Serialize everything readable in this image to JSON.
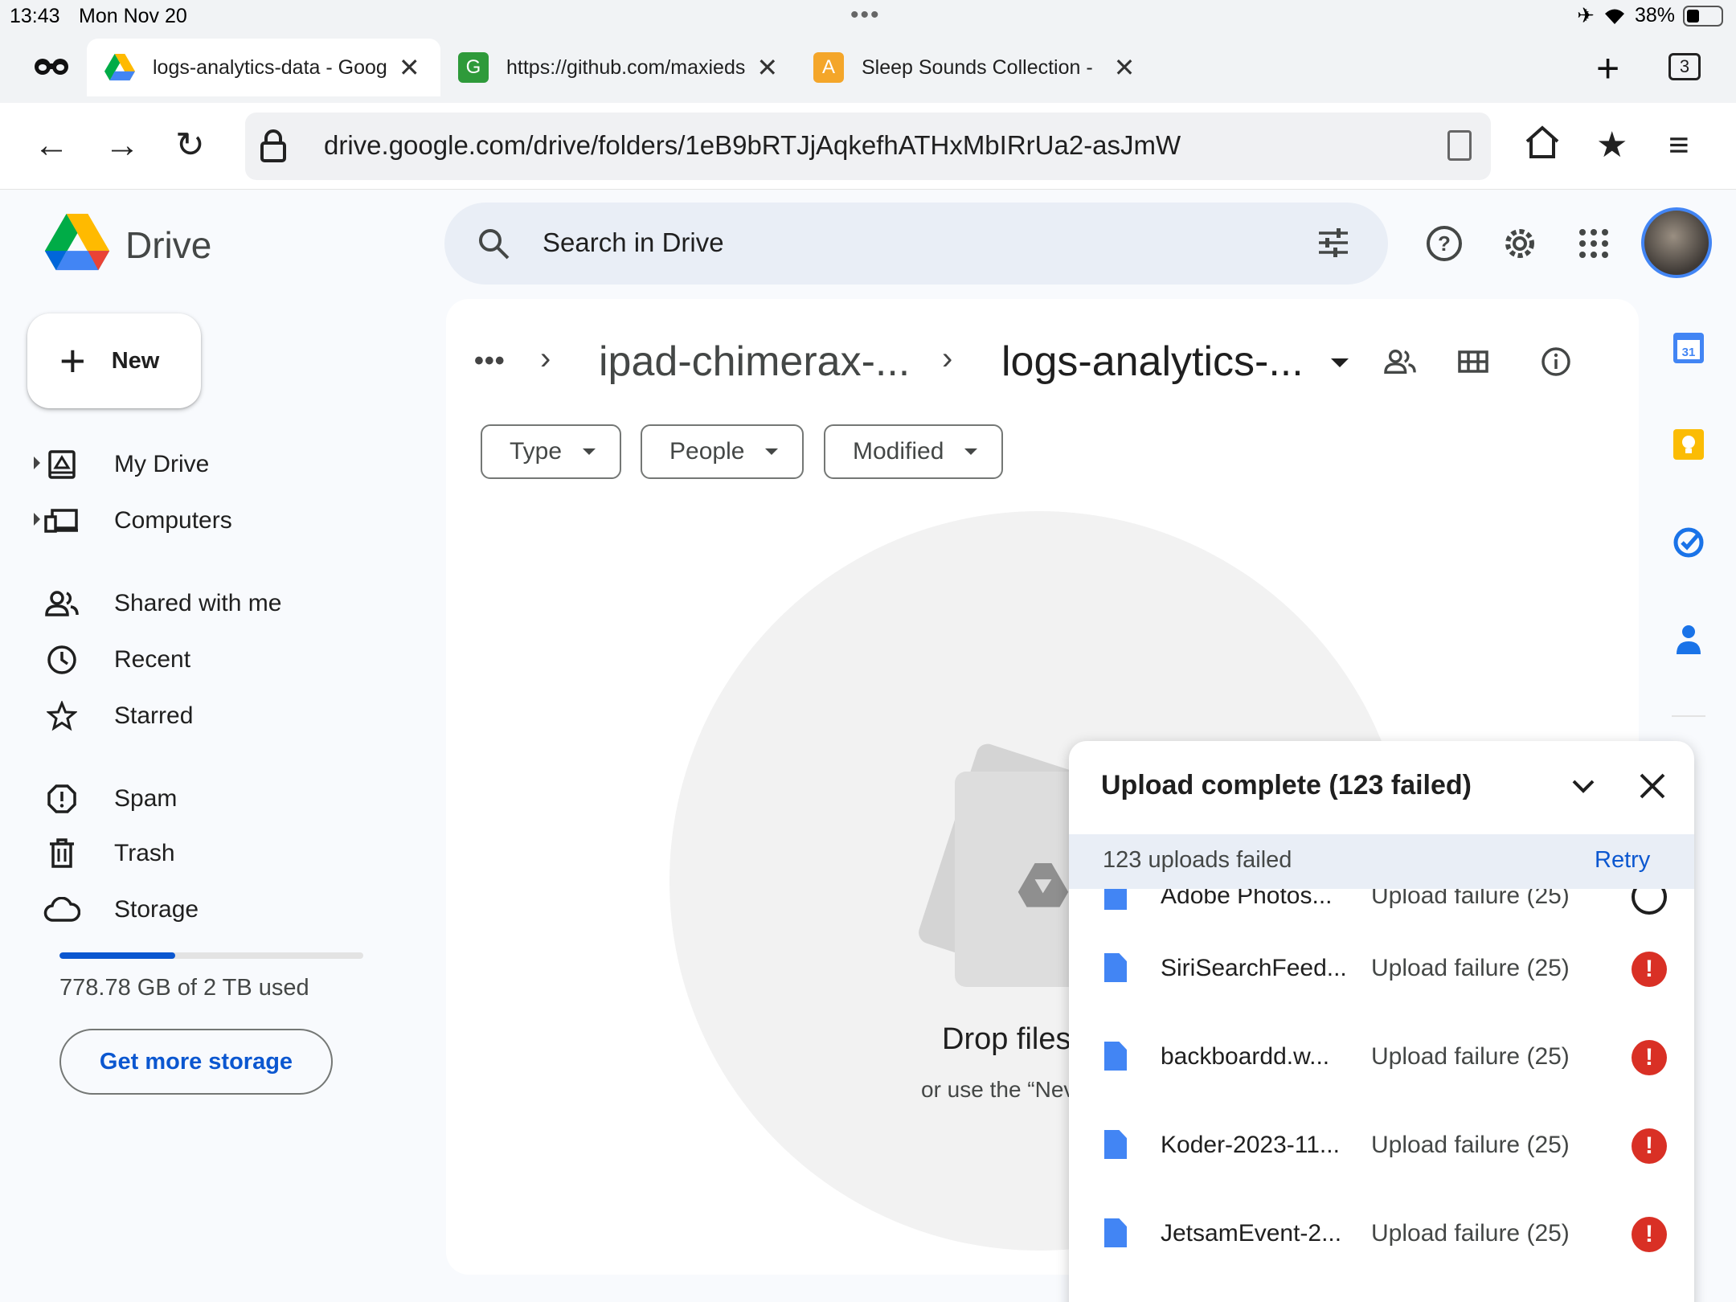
{
  "status_bar": {
    "time": "13:43",
    "date": "Mon Nov 20",
    "battery": "38%",
    "battery_level": 0.38
  },
  "tabs": [
    {
      "title": "logs-analytics-data - Goog",
      "favicon": "google-drive",
      "active": true
    },
    {
      "title": "https://github.com/maxieds",
      "favicon": "G",
      "favicon_color": "#2e9a3a",
      "active": false
    },
    {
      "title": "Sleep Sounds Collection -",
      "favicon": "A",
      "favicon_color": "#f4a62a",
      "active": false
    }
  ],
  "tab_count": "3",
  "address_bar": {
    "url": "drive.google.com/drive/folders/1eB9bRTJjAqkefhATHxMbIRrUa2-asJmW"
  },
  "app": {
    "name": "Drive"
  },
  "search": {
    "placeholder": "Search in Drive"
  },
  "sidebar": {
    "new_label": "New",
    "items": [
      {
        "label": "My Drive",
        "icon": "my-drive-icon"
      },
      {
        "label": "Computers",
        "icon": "computers-icon"
      },
      {
        "label": "Shared with me",
        "icon": "people-icon"
      },
      {
        "label": "Recent",
        "icon": "clock-icon"
      },
      {
        "label": "Starred",
        "icon": "star-icon"
      },
      {
        "label": "Spam",
        "icon": "spam-icon"
      },
      {
        "label": "Trash",
        "icon": "trash-icon"
      },
      {
        "label": "Storage",
        "icon": "cloud-icon"
      }
    ],
    "storage_text": "778.78 GB of 2 TB used",
    "storage_fraction": 0.38,
    "get_more_label": "Get more storage"
  },
  "breadcrumb": {
    "overflow": "•••",
    "parent": "ipad-chimerax-...",
    "current": "logs-analytics-..."
  },
  "filters": [
    {
      "label": "Type"
    },
    {
      "label": "People"
    },
    {
      "label": "Modified"
    }
  ],
  "empty_state": {
    "title": "Drop files",
    "subtitle": "or use the “Nev"
  },
  "upload_panel": {
    "title": "Upload complete (123 failed)",
    "summary": "123 uploads failed",
    "retry_label": "Retry",
    "partial_row": {
      "name": "Adobe Photos...",
      "status": "Upload failure (25)"
    },
    "rows": [
      {
        "name": "SiriSearchFeed...",
        "status": "Upload failure (25)"
      },
      {
        "name": "backboardd.w...",
        "status": "Upload failure (25)"
      },
      {
        "name": "Koder-2023-11...",
        "status": "Upload failure (25)"
      },
      {
        "name": "JetsamEvent-2...",
        "status": "Upload failure (25)"
      }
    ]
  },
  "colors": {
    "accent": "#0b57d0",
    "error": "#d93025",
    "file_icon": "#4285f4"
  }
}
